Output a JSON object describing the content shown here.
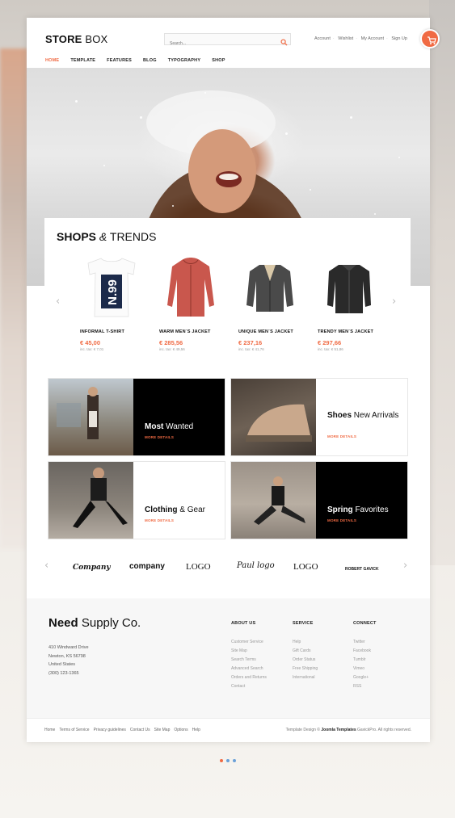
{
  "header": {
    "logo_bold": "STORE",
    "logo_light": " BOX",
    "search_placeholder": "Search...",
    "account_links": [
      "Account",
      "Wishlist",
      "My Account",
      "Sign Up"
    ]
  },
  "nav": [
    "HOME",
    "TEMPLATE",
    "FEATURES",
    "BLOG",
    "TYPOGRAPHY",
    "SHOP"
  ],
  "shops": {
    "title_bold": "SHOPS",
    "title_amp": " &",
    "title_light": " TRENDS",
    "products": [
      {
        "name": "INFORMAL T-SHIRT",
        "price": "€ 45,00",
        "tax": "inc. tax: € 7,01"
      },
      {
        "name": "WARM MEN`S JACKET",
        "price": "€ 285,56",
        "tax": "inc. tax: € 49,56"
      },
      {
        "name": "UNIQUE MEN`S JACKET",
        "price": "€ 237,16",
        "tax": "inc. tax: € 41,76"
      },
      {
        "name": "TRENDY MEN`S JACKET",
        "price": "€ 297,66",
        "tax": "inc. tax: € 51,86"
      }
    ],
    "tshirt_print": "N.99"
  },
  "promos": [
    {
      "bold": "Most",
      "light": " Wanted",
      "more": "MORE DETAILS"
    },
    {
      "bold": "Shoes",
      "light": " New Arrivals",
      "more": "MORE DETAILS"
    },
    {
      "bold": "Clothing",
      "light": " & Gear",
      "more": "MORE DETAILS"
    },
    {
      "bold": "Spring",
      "light": " Favorites",
      "more": "MORE DETAILS"
    }
  ],
  "brand_logos": [
    "Company",
    "company",
    "LOGO",
    "Paul logo",
    "LOGO",
    "ROBERT GAVICK"
  ],
  "footer": {
    "brand_bold": "Need",
    "brand_light": " Supply Co.",
    "address": [
      "410 Windward Drive",
      "Newton, KS 56798",
      "United States",
      "(300) 123-1365"
    ],
    "columns": [
      {
        "title": "ABOUT US",
        "items": [
          "Customer Service",
          "Site Map",
          "Search Terms",
          "Advanced Search",
          "Orders and Returns",
          "Contact"
        ]
      },
      {
        "title": "SERVICE",
        "items": [
          "Help",
          "Gift Cards",
          "Order Status",
          "Free Shipping",
          "International"
        ]
      },
      {
        "title": "CONNECT",
        "items": [
          "Twitter",
          "Facebook",
          "Tumblr",
          "Vimeo",
          "Google+",
          "RSS"
        ]
      }
    ],
    "bottom_links": [
      "Home",
      "Terms of Service",
      "Privacy guidelines",
      "Contact Us",
      "Site Map",
      "Options",
      "Help"
    ],
    "copyright_prefix": "Template Design © ",
    "copyright_brand": "Joomla Templates",
    "copyright_suffix": " GavickPro. All rights reserved."
  },
  "colors": {
    "accent": "#f06a43",
    "dot_active": "#f06a43",
    "dot_inactive": "#6aa0d8"
  }
}
